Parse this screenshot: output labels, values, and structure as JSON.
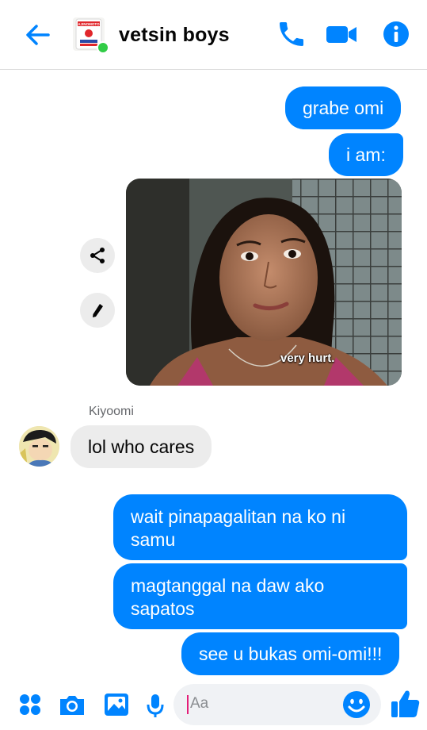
{
  "header": {
    "title": "vetsin boys",
    "avatar_label": "AJINOMOTO"
  },
  "messages": {
    "m1": "grabe omi",
    "m2": "i am:",
    "photo_caption": "very hurt.",
    "sender_name": "Kiyoomi",
    "m3": "lol who cares",
    "m4_line1": "wait pinapagalitan na ko ni",
    "m4_line2": "samu",
    "m5_line1": "magtanggal na daw ako",
    "m5_line2": "sapatos",
    "m6": "see u bukas omi-omi!!!"
  },
  "composer": {
    "placeholder": "Aa"
  },
  "colors": {
    "accent": "#0084ff",
    "outgoing_bubble": "#0084ff",
    "incoming_bubble": "#ececec",
    "online": "#31cc46"
  },
  "icons": {
    "back": "arrow-left",
    "call": "phone",
    "video": "video-camera",
    "info": "info-circle",
    "share": "share-nodes",
    "edit": "pencil",
    "menu": "four-dots",
    "camera": "camera",
    "gallery": "image",
    "mic": "microphone",
    "emoji": "smiley",
    "like": "thumbs-up"
  }
}
